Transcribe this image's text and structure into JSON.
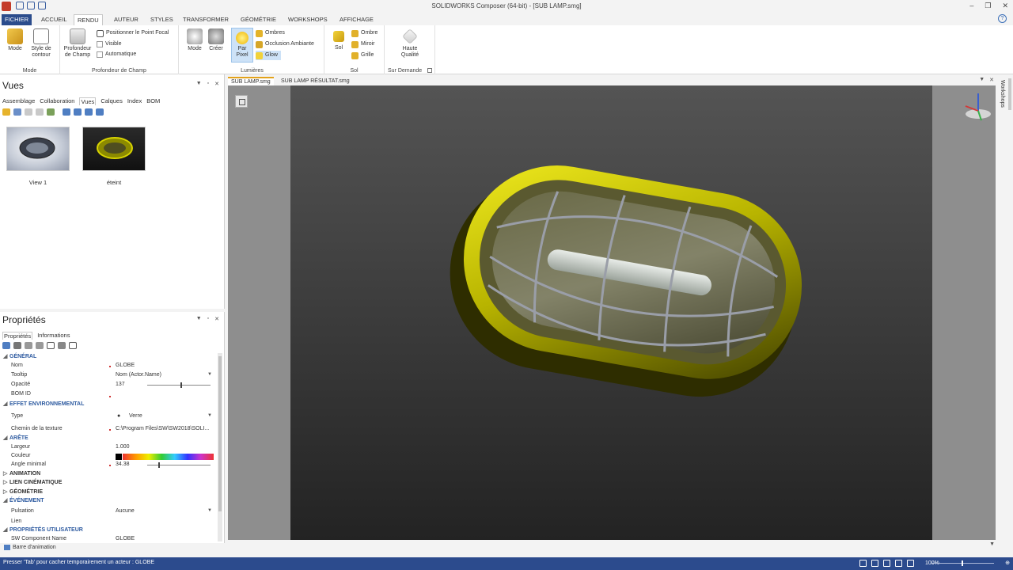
{
  "window": {
    "title": "SOLIDWORKS Composer (64-bit) - [SUB LAMP.smg]",
    "help_glyph": "?"
  },
  "ribbon_tabs": [
    "FICHIER",
    "ACCUEIL",
    "RENDU",
    "AUTEUR",
    "STYLES",
    "TRANSFORMER",
    "GÉOMÉTRIE",
    "WORKSHOPS",
    "AFFICHAGE"
  ],
  "ribbon": {
    "mode_group": {
      "label": "Mode",
      "mode": "Mode",
      "style_de": "Style de",
      "contour": "contour"
    },
    "depth_group": {
      "label": "Profondeur de Champ",
      "profondeur": "Profondeur",
      "de_champ": "de Champ",
      "focal": "Positionner le Point Focal",
      "visible": "Visible",
      "auto": "Automatique"
    },
    "lights_group": {
      "label": "Lumières",
      "mode": "Mode",
      "creer": "Créer",
      "par": "Par",
      "pixel": "Pixel",
      "ombres": "Ombres",
      "occlusion": "Occlusion Ambiante",
      "glow": "Glow"
    },
    "floor_group": {
      "label": "Sol",
      "sol": "Sol",
      "ombre": "Ombre",
      "miroir": "Miroir",
      "grille": "Grille"
    },
    "demand_group": {
      "label": "Sur Demande",
      "haute": "Haute",
      "qualite": "Qualité"
    }
  },
  "vues_panel": {
    "title": "Vues",
    "tabs": [
      "Assemblage",
      "Collaboration",
      "Vues",
      "Calques",
      "Index",
      "BOM"
    ],
    "views": [
      {
        "label": "View 1"
      },
      {
        "label": "éteint"
      }
    ]
  },
  "props_panel": {
    "title": "Propriétés",
    "tabs": [
      "Propriétés",
      "Informations"
    ],
    "sections": {
      "general": "GÉNÉRAL",
      "env": "EFFET ENVIRONNEMENTAL",
      "arete": "ARÊTE",
      "animation": "ANIMATION",
      "lien": "LIEN CINÉMATIQUE",
      "geometrie": "GÉOMÉTRIE",
      "evenement": "ÉVÉNEMENT",
      "user": "PROPRIÉTÉS UTILISATEUR"
    },
    "rows": {
      "nom_k": "Nom",
      "nom_v": "GLOBE",
      "tooltip_k": "Tooltip",
      "tooltip_v": "Nom (Actor.Name)",
      "opacite_k": "Opacité",
      "opacite_v": "137",
      "bom_k": "BOM ID",
      "type_k": "Type",
      "type_v": "Verre",
      "chemin_k": "Chemin de la texture",
      "chemin_v": "C:\\Program Files\\SW\\SW2018\\SOLI...",
      "largeur_k": "Largeur",
      "largeur_v": "1.000",
      "couleur_k": "Couleur",
      "angle_k": "Angle minimal",
      "angle_v": "34.38",
      "pulsation_k": "Pulsation",
      "pulsation_v": "Aucune",
      "lien_k": "Lien",
      "swcomp_k": "SW Component Name",
      "swcomp_v": "GLOBE"
    },
    "opacity_fraction": 0.54,
    "angle_fraction": 0.18
  },
  "animation_bar": "Barre d'animation",
  "doc_tabs": [
    "SUB LAMP.smg",
    "SUB LAMP RÉSULTAT.smg"
  ],
  "right_strip_label": "Workshops",
  "status": {
    "message": "Presser 'Tab' pour cacher temporairement un acteur : GLOBE",
    "zoom": "100%",
    "zoom_fraction": 0.5
  },
  "colors": {
    "accent": "#2b4c8c",
    "lamp_frame": "#c8c400",
    "section_blue": "#2d5aa0"
  }
}
